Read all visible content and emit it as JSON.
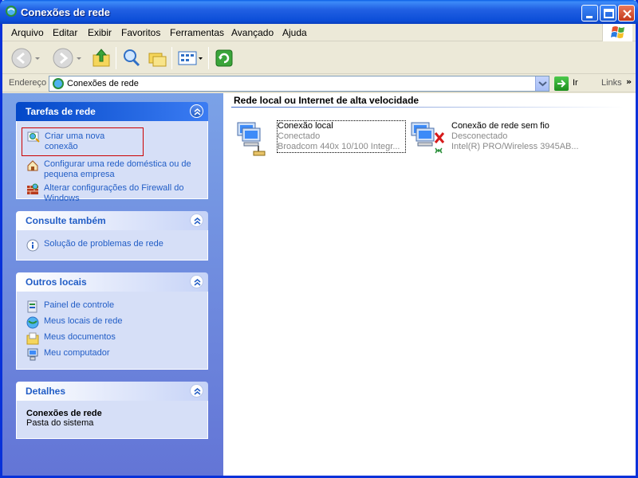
{
  "window": {
    "title": "Conexões de rede"
  },
  "menu": {
    "items": [
      "Arquivo",
      "Editar",
      "Exibir",
      "Favoritos",
      "Ferramentas",
      "Avançado",
      "Ajuda"
    ]
  },
  "address": {
    "label": "Endereço",
    "value": "Conexões de rede",
    "go_label": "Ir",
    "links_label": "Links"
  },
  "left_panels": {
    "tasks": {
      "title": "Tarefas de rede",
      "items": [
        {
          "label": "Criar uma nova conexão",
          "icon": "new-connection-icon"
        },
        {
          "label": "Configurar uma rede doméstica ou de pequena empresa",
          "icon": "home-network-icon"
        },
        {
          "label": "Alterar configurações do Firewall do Windows",
          "icon": "firewall-icon"
        }
      ]
    },
    "see_also": {
      "title": "Consulte também",
      "items": [
        {
          "label": "Solução de problemas de rede",
          "icon": "info-icon"
        }
      ]
    },
    "other_places": {
      "title": "Outros locais",
      "items": [
        {
          "label": "Painel de controle",
          "icon": "control-panel-icon"
        },
        {
          "label": "Meus locais de rede",
          "icon": "network-places-icon"
        },
        {
          "label": "Meus documentos",
          "icon": "documents-folder-icon"
        },
        {
          "label": "Meu computador",
          "icon": "computer-icon"
        }
      ]
    },
    "details": {
      "title": "Detalhes",
      "name": "Conexões de rede",
      "type": "Pasta do sistema"
    }
  },
  "content": {
    "group_title": "Rede local ou Internet de alta velocidade",
    "connections": [
      {
        "name": "Conexão local",
        "status": "Conectado",
        "device": "Broadcom 440x 10/100 Integr..."
      },
      {
        "name": "Conexão de rede sem fio",
        "status": "Desconectado",
        "device": "Intel(R) PRO/Wireless 3945AB..."
      }
    ]
  },
  "colors": {
    "link": "#215dc6",
    "titlebar": "#0a5fe6",
    "leftpane": "#7ba2e7"
  }
}
